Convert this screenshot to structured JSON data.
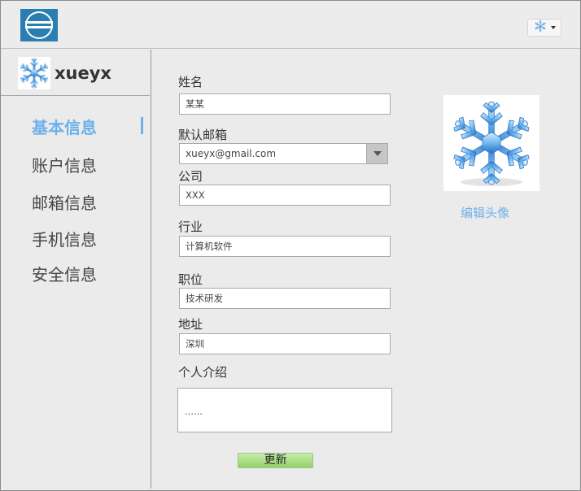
{
  "header": {
    "logo_icon": "app-logo-icon",
    "user_menu_icon": "snowflake-icon"
  },
  "sidebar": {
    "username": "xueyx",
    "avatar_icon": "snowflake-icon",
    "items": [
      {
        "label": "基本信息",
        "active": true
      },
      {
        "label": "账户信息",
        "active": false
      },
      {
        "label": "邮箱信息",
        "active": false
      },
      {
        "label": "手机信息",
        "active": false
      },
      {
        "label": "安全信息",
        "active": false
      }
    ]
  },
  "form": {
    "name": {
      "label": "姓名",
      "value": "某某"
    },
    "email": {
      "label": "默认邮箱",
      "value": "xueyx@gmail.com"
    },
    "company": {
      "label": "公司",
      "value": "XXX"
    },
    "industry": {
      "label": "行业",
      "value": "计算机软件"
    },
    "position": {
      "label": "职位",
      "value": "技术研发"
    },
    "address": {
      "label": "地址",
      "value": "深圳"
    },
    "intro": {
      "label": "个人介绍",
      "value": "……"
    },
    "update_label": "更新"
  },
  "avatar_panel": {
    "edit_label": "编辑头像",
    "avatar_icon": "snowflake-icon"
  },
  "colors": {
    "accent": "#6eb1ea",
    "button_green": "#a8dc84",
    "background": "#ebebeb"
  }
}
